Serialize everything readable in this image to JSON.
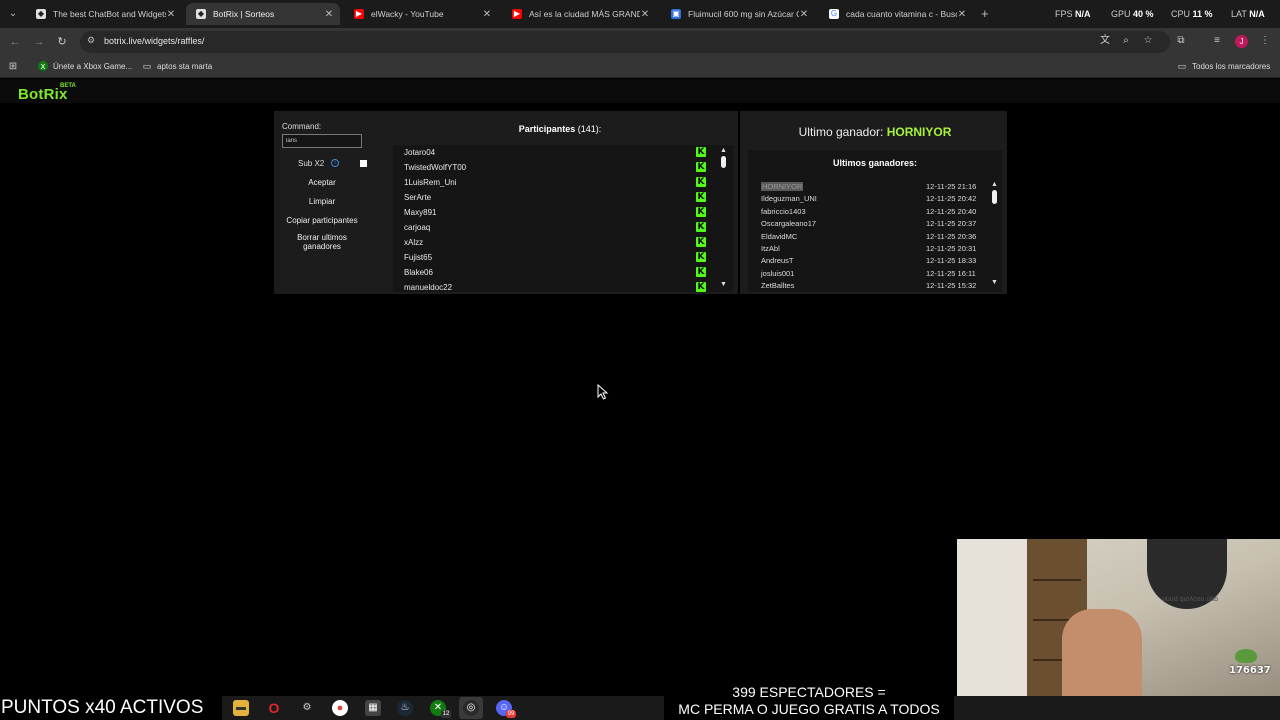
{
  "browser": {
    "tabs": [
      {
        "title": "The best ChatBot and Widgets",
        "favicon": "botrix-icon",
        "active": false
      },
      {
        "title": "BotRix | Sorteos",
        "favicon": "botrix-icon",
        "active": true
      },
      {
        "title": "elWacky - YouTube",
        "favicon": "youtube-icon",
        "active": false
      },
      {
        "title": "Así es la ciudad MÁS GRANDE",
        "favicon": "youtube-icon",
        "active": false
      },
      {
        "title": "Fluimucil 600 mg sin Azúcar Ca",
        "favicon": "store-icon",
        "active": false
      },
      {
        "title": "cada cuanto vitamina c - Busca",
        "favicon": "google-icon",
        "active": false
      }
    ],
    "url": "botrix.live/widgets/raffles/",
    "perf": [
      {
        "label": "FPS",
        "value": "N/A"
      },
      {
        "label": "GPU",
        "value": "40 %"
      },
      {
        "label": "CPU",
        "value": "11 %"
      },
      {
        "label": "LAT",
        "value": "N/A"
      }
    ],
    "profile_initial": "J",
    "bookmarks": {
      "items": [
        "Únete a Xbox Game...",
        "aptos sta marta"
      ],
      "all_label": "Todos los marcadores"
    }
  },
  "site": {
    "logo": "BotRix",
    "beta": "BETA"
  },
  "controls": {
    "command_label": "Command:",
    "command_value": "laris",
    "sub_label": "Sub X2",
    "sub_checked": false,
    "buttons": {
      "accept": "Aceptar",
      "clear": "Limpiar",
      "copy": "Copiar participantes",
      "delete_line1": "Borrar ultimos",
      "delete_line2": "ganadores"
    }
  },
  "participants": {
    "title": "Participantes",
    "count": "(141):",
    "names": [
      "Jotaro04",
      "TwistedWolfYT00",
      "1LuisRem_Uni",
      "SerArte",
      "Maxy891",
      "carjoaq",
      "xAlzz",
      "Fujist65",
      "Blake06",
      "manueldoc22"
    ],
    "platform_icon": "kick-icon",
    "platform_color": "#53fc18"
  },
  "winner": {
    "label": "Ultimo ganador:",
    "name": "HORNIYOR",
    "name_color": "#a6f33a",
    "list_title": "Ultimos ganadores:",
    "recent": [
      {
        "name": "HORNIYOR",
        "date": "12-11-25 21:16"
      },
      {
        "name": "Ildeguzman_UNI",
        "date": "12-11-25 20:42"
      },
      {
        "name": "fabriccio1403",
        "date": "12-11-25 20:40"
      },
      {
        "name": "Oscargaleano17",
        "date": "12-11-25 20:37"
      },
      {
        "name": "EldavidMC",
        "date": "12-11-25 20:36"
      },
      {
        "name": "ItzAbl",
        "date": "12-11-25 20:31"
      },
      {
        "name": "AndreusT",
        "date": "12-11-25 18:33"
      },
      {
        "name": "josluis001",
        "date": "12-11-25 16:11"
      },
      {
        "name": "ZetBalltes",
        "date": "12-11-25 15:32"
      }
    ]
  },
  "overlay": {
    "puntos": "PUNTOS x40 ACTIVOS",
    "espectadores_line1": "399 ESPECTADORES =",
    "espectadores_line2": "MC PERMA O JUEGO GRATIS A TODOS",
    "webcam_counter": "176637",
    "webcam_mirrored_text": "ddu uoɔʎoɹp buiɹu"
  },
  "taskbar": {
    "icons": [
      "file-explorer-icon",
      "opera-icon",
      "app-icon",
      "chrome-icon",
      "calculator-icon",
      "steam-icon",
      "xbox-icon",
      "obs-icon",
      "discord-icon"
    ],
    "xbox_badge": "12",
    "discord_badge": "99"
  }
}
